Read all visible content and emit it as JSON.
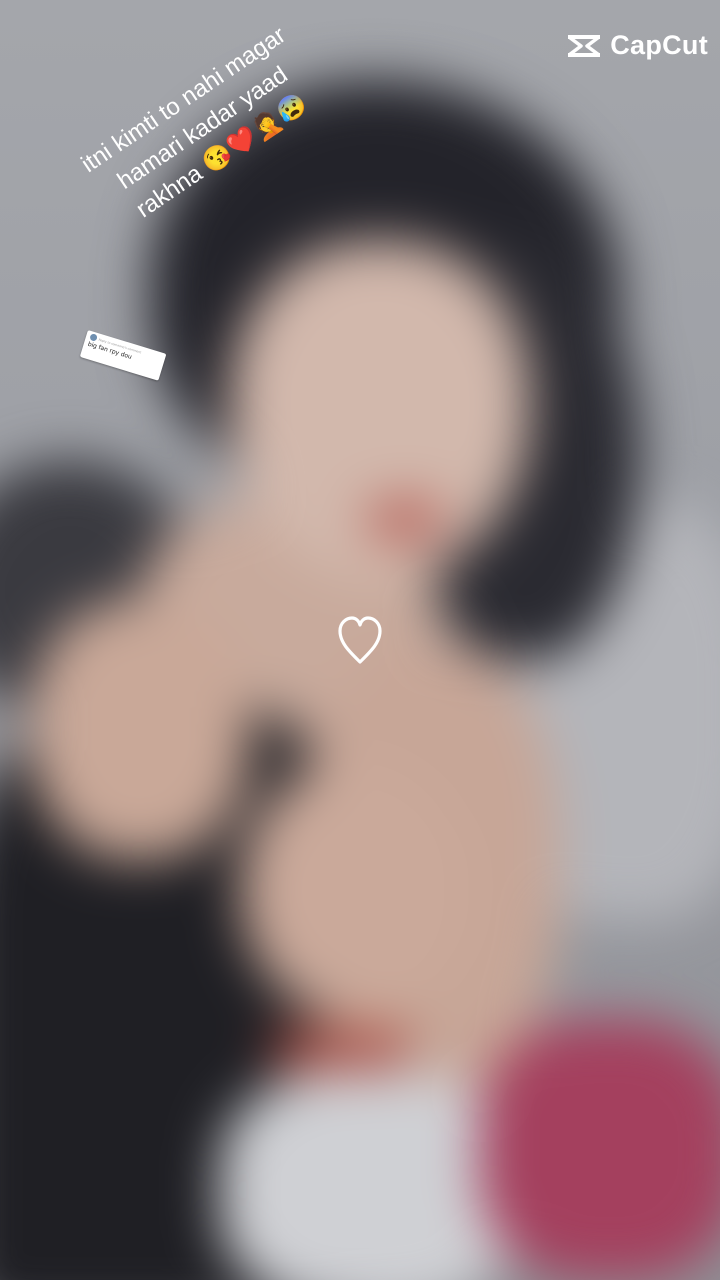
{
  "watermark": {
    "brand_name": "CapCut",
    "icon": "capcut-logo-icon"
  },
  "caption": {
    "lines": [
      "itni kimti to nahi magar",
      "hamari kadar yaad",
      "rakhna 😘❤️🤦😰"
    ]
  },
  "comment_reply": {
    "meta": "Reply to someone's comment",
    "text": "big fan rpy dou"
  },
  "heart": {
    "icon": "heart-outline-icon",
    "color": "#ffffff"
  },
  "colors": {
    "text": "#ffffff",
    "background": "#9ea0a6"
  }
}
